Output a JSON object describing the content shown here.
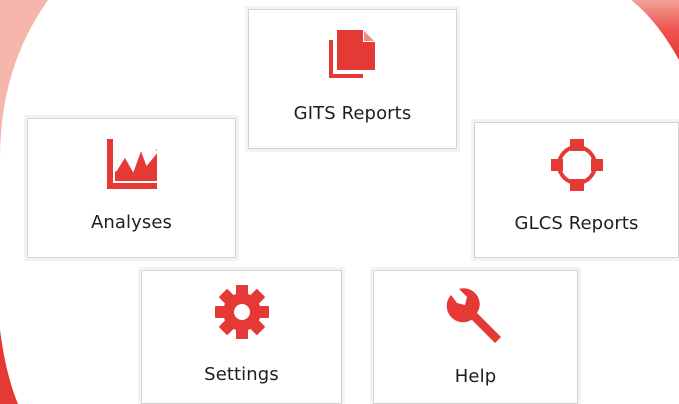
{
  "colors": {
    "accent": "#e53935",
    "background_arc": "#ef5350",
    "tile_border": "#d4d4d4",
    "label_text": "#1e1e1e"
  },
  "tiles": [
    {
      "id": "gits",
      "label": "GITS Reports",
      "icon": "documents-icon"
    },
    {
      "id": "analyses",
      "label": "Analyses",
      "icon": "chart-line-icon"
    },
    {
      "id": "glcs",
      "label": "GLCS Reports",
      "icon": "network-ring-icon"
    },
    {
      "id": "settings",
      "label": "Settings",
      "icon": "gear-icon"
    },
    {
      "id": "help",
      "label": "Help",
      "icon": "wrench-icon"
    }
  ]
}
